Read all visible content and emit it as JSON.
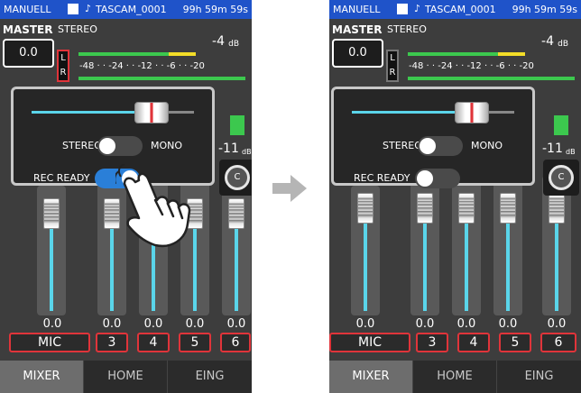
{
  "status": {
    "mode": "MANUELL",
    "note_icon": "music-note-icon",
    "filename": "TASCAM_0001",
    "remaining": "99h 59m 59s"
  },
  "master": {
    "label": "MASTER",
    "stereo_label": "STEREO",
    "value": "0.0",
    "lr_l": "L",
    "lr_r": "R",
    "db_value": "-4",
    "db_unit": "dB",
    "scale": "-48 · · -24 · · -12 · · -6 · · -20"
  },
  "channels": [
    {
      "label": "MIC",
      "value": "0.0"
    },
    {
      "label": "3",
      "value": "0.0"
    },
    {
      "label": "4",
      "value": "0.0"
    },
    {
      "label": "5",
      "value": "0.0"
    },
    {
      "label": "6",
      "value": "0.0"
    }
  ],
  "side": {
    "db_value": "-11",
    "db_unit": "dB",
    "knob": "C"
  },
  "popup": {
    "stereo_label": "STEREO",
    "mono_label": "MONO",
    "rec_ready_label": "REC READY"
  },
  "before": {
    "stereo_mono_toggle": "stereo",
    "rec_ready": true
  },
  "after": {
    "stereo_mono_toggle": "stereo",
    "rec_ready": false
  },
  "tabs": [
    "MIXER",
    "HOME",
    "EING"
  ],
  "active_tab": "MIXER",
  "colors": {
    "status_bar": "#1f53c9",
    "accent_cyan": "#5ad5ea",
    "red": "#e0343a",
    "meter_green": "#3cc84e",
    "meter_yellow": "#f3dd28",
    "toggle_on": "#2a7fd8"
  }
}
